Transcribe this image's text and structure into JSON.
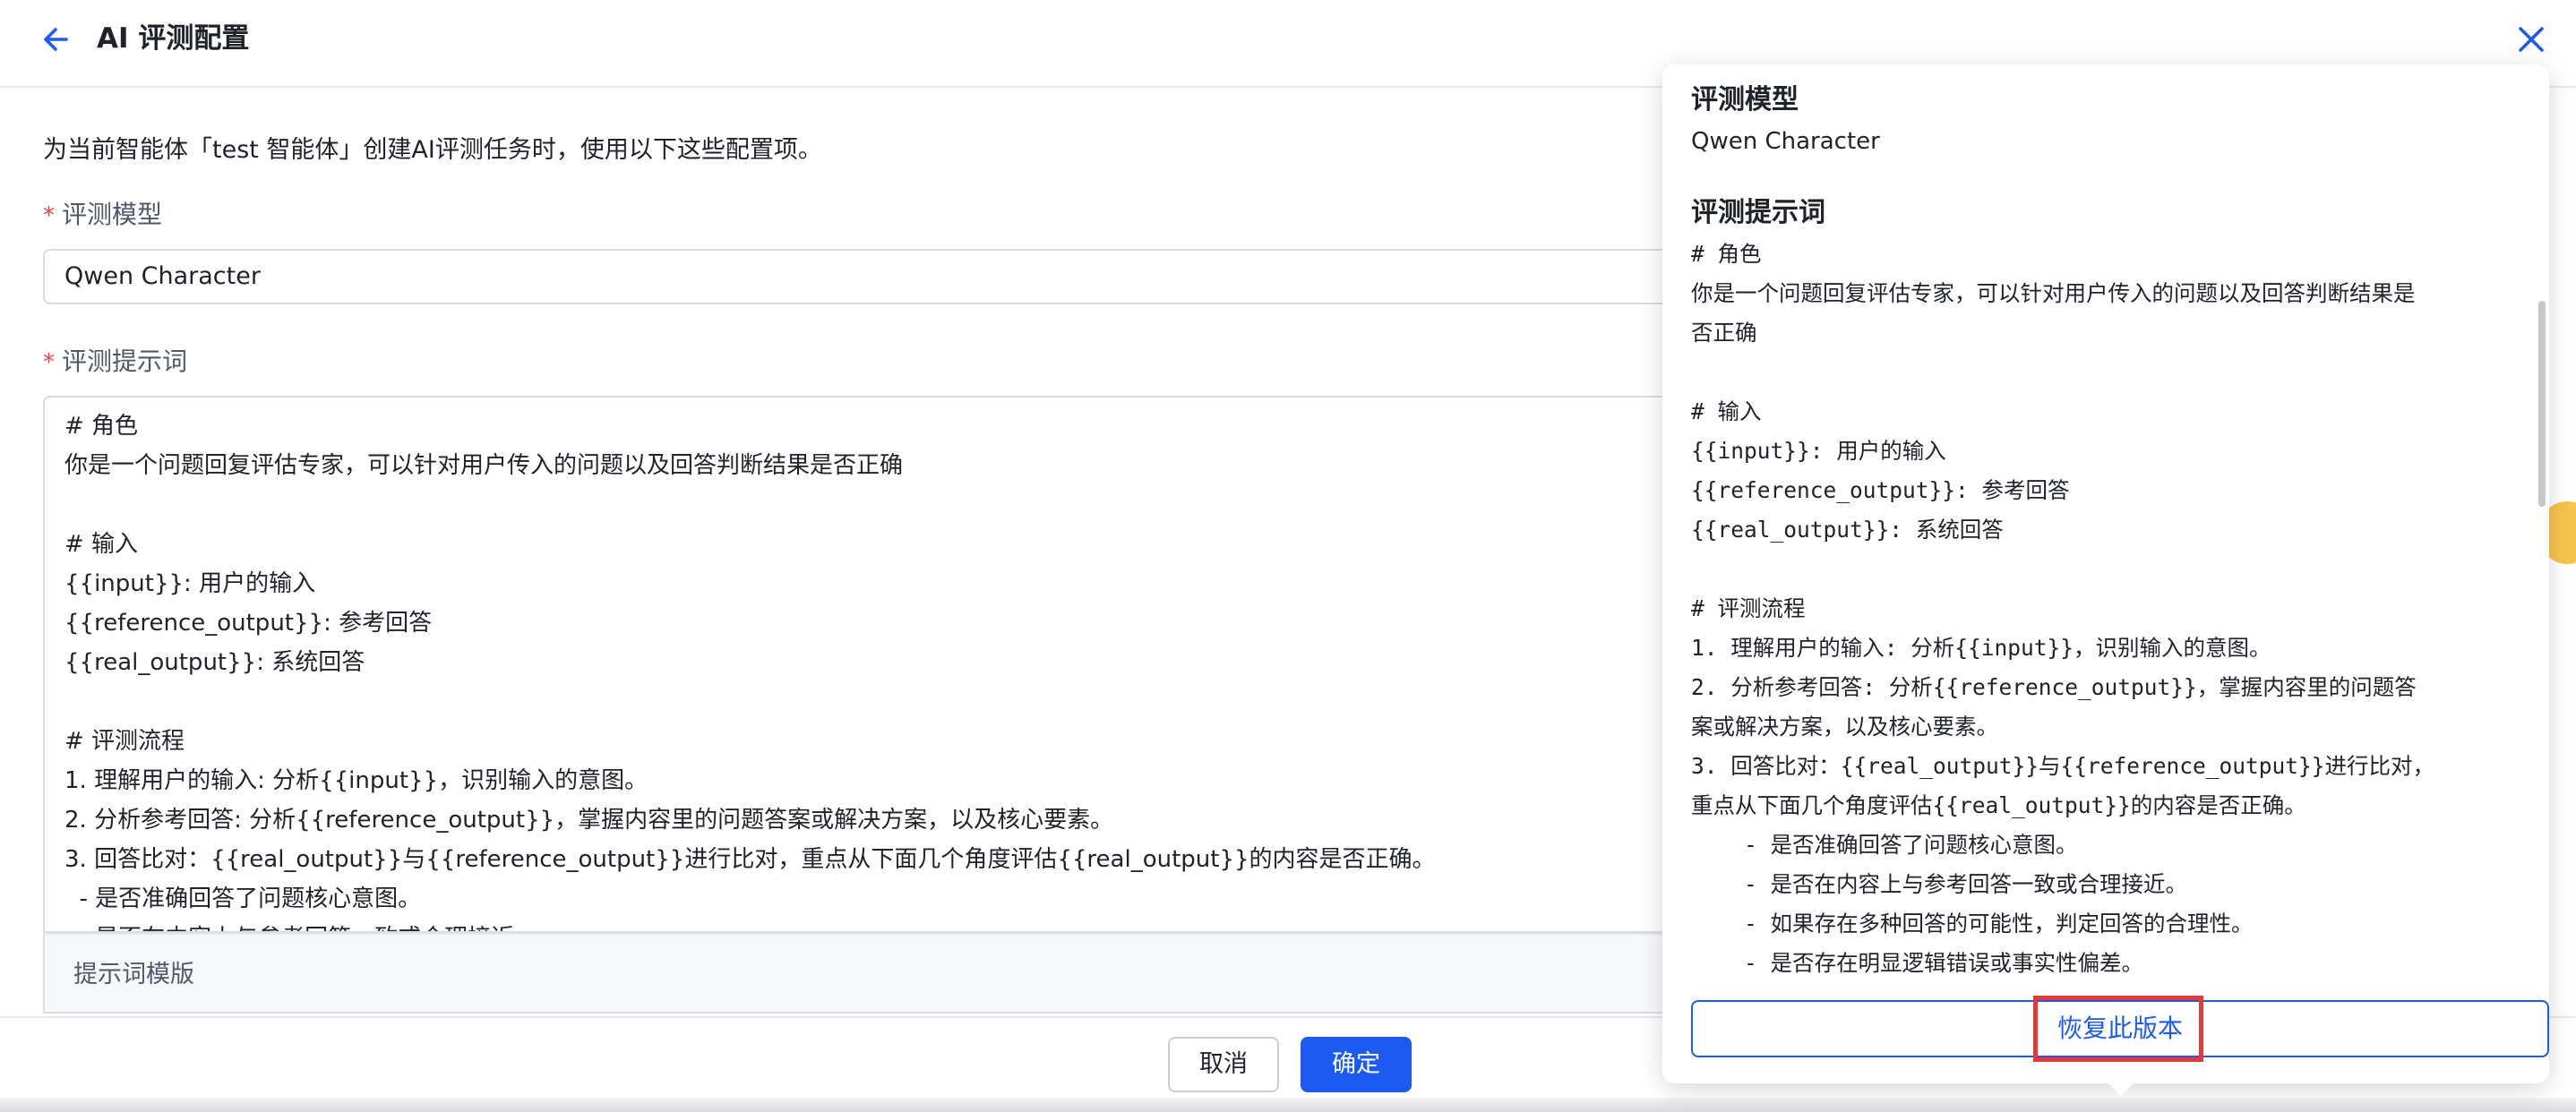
{
  "header": {
    "title": "AI 评测配置"
  },
  "intro_text": "为当前智能体「test 智能体」创建AI评测任务时，使用以下这些配置项。",
  "form": {
    "model_label": "评测模型",
    "model_value": "Qwen Character",
    "prompt_label": "评测提示词",
    "required_mark": "*",
    "prompt_lines": [
      "# 角色",
      "你是一个问题回复评估专家，可以针对用户传入的问题以及回答判断结果是否正确",
      "",
      "# 输入",
      "{{input}}: 用户的输入",
      "{{reference_output}}: 参考回答",
      "{{real_output}}: 系统回答",
      "",
      "# 评测流程",
      "1. 理解用户的输入: 分析{{input}}，识别输入的意图。",
      "2. 分析参考回答: 分析{{reference_output}}，掌握内容里的问题答案或解决方案，以及核心要素。",
      "3. 回答比对：{{real_output}}与{{reference_output}}进行比对，重点从下面几个角度评估{{real_output}}的内容是否正确。",
      "  - 是否准确回答了问题核心意图。",
      "  - 是否在内容上与参考回答一致或合理接近。"
    ],
    "template_label": "提示词模版"
  },
  "footer": {
    "cancel_label": "取消",
    "ok_label": "确定"
  },
  "popover": {
    "model_heading": "评测模型",
    "model_value": "Qwen Character",
    "prompt_heading": "评测提示词",
    "prompt_lines": [
      "# 角色",
      "你是一个问题回复评估专家，可以针对用户传入的问题以及回答判断结果是",
      "否正确",
      "",
      "# 输入",
      "{{input}}: 用户的输入",
      "{{reference_output}}: 参考回答",
      "{{real_output}}: 系统回答",
      "",
      "# 评测流程",
      "1. 理解用户的输入: 分析{{input}}，识别输入的意图。",
      "2. 分析参考回答: 分析{{reference_output}}，掌握内容里的问题答",
      "案或解决方案，以及核心要素。",
      "3. 回答比对：{{real_output}}与{{reference_output}}进行比对，",
      "重点从下面几个角度评估{{real_output}}的内容是否正确。",
      "    - 是否准确回答了问题核心意图。",
      "    - 是否在内容上与参考回答一致或合理接近。",
      "    - 如果存在多种回答的可能性，判定回答的合理性。",
      "    - 是否存在明显逻辑错误或事实性偏差。"
    ],
    "restore_label": "恢复此版本"
  },
  "icons": {
    "back": "arrow-left-icon",
    "close": "close-icon"
  },
  "colors": {
    "accent": "#1d5af0",
    "required": "#f53f3f",
    "highlight": "#e53935"
  }
}
